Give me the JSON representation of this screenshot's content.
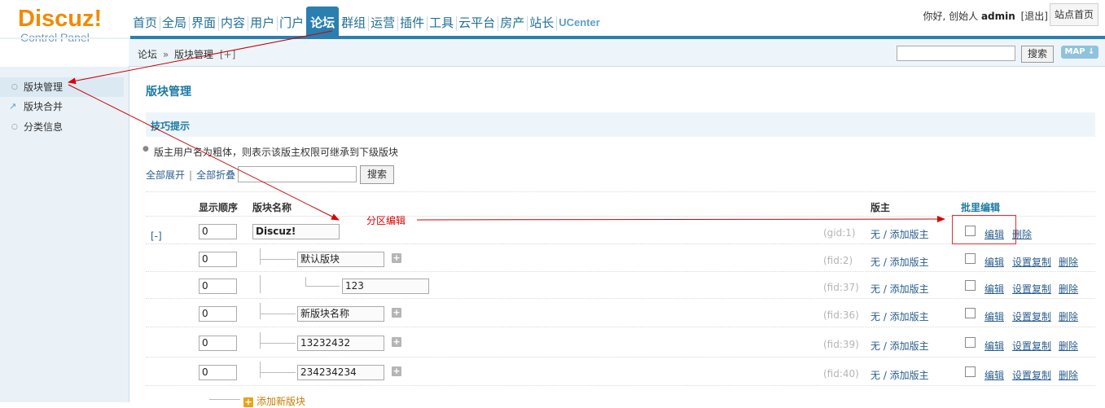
{
  "logo": {
    "main": "Discuz!",
    "sub": "Control Panel"
  },
  "nav": {
    "items": [
      "首页",
      "全局",
      "界面",
      "内容",
      "用户",
      "门户",
      "论坛",
      "群组",
      "运营",
      "插件",
      "工具",
      "云平台",
      "房产",
      "站长",
      "UCenter"
    ],
    "active_index": 6
  },
  "user": {
    "greeting": "你好, 创始人",
    "name": "admin",
    "logout": "[退出]",
    "site_home": "站点首页"
  },
  "breadcrumb": {
    "parent": "论坛",
    "separator": "»",
    "current": "版块管理",
    "plus": "[+]"
  },
  "top_search": {
    "button": "搜索",
    "map": "MAP ↓"
  },
  "sidebar": {
    "items": [
      {
        "label": "版块管理",
        "icon": "circle-icon",
        "active": true
      },
      {
        "label": "版块合并",
        "icon": "external-link-icon",
        "active": false
      },
      {
        "label": "分类信息",
        "icon": "circle-icon",
        "active": false
      }
    ]
  },
  "page": {
    "title": "版块管理",
    "tips_title": "技巧提示",
    "tip": "版主用户名为粗体，则表示该版主权限可继承到下级版块",
    "expand_all": "全部展开",
    "collapse_all": "全部折叠",
    "search_button": "搜索"
  },
  "table": {
    "headers": {
      "order": "显示顺序",
      "name": "版块名称",
      "moderators": "版主",
      "batch_edit": "批里编辑"
    },
    "rows": [
      {
        "toggle": "[-]",
        "order": "0",
        "name": "Discuz!",
        "id": "(gid:1)",
        "mods": "无 / 添加版主",
        "edit": "编辑",
        "copy": "",
        "del": "删除"
      },
      {
        "order": "0",
        "name": "默认版块",
        "id": "(fid:2)",
        "mods": "无 / 添加版主",
        "edit": "编辑",
        "copy": "设置复制",
        "del": "删除"
      },
      {
        "order": "0",
        "name": "123",
        "id": "(fid:37)",
        "mods": "无 / 添加版主",
        "edit": "编辑",
        "copy": "设置复制",
        "del": "删除"
      },
      {
        "order": "0",
        "name": "新版块名称",
        "id": "(fid:36)",
        "mods": "无 / 添加版主",
        "edit": "编辑",
        "copy": "设置复制",
        "del": "删除"
      },
      {
        "order": "0",
        "name": "13232432",
        "id": "(fid:39)",
        "mods": "无 / 添加版主",
        "edit": "编辑",
        "copy": "设置复制",
        "del": "删除"
      },
      {
        "order": "0",
        "name": "234234234",
        "id": "(fid:40)",
        "mods": "无 / 添加版主",
        "edit": "编辑",
        "copy": "设置复制",
        "del": "删除"
      }
    ],
    "add_new": "添加新版块"
  },
  "annotation": {
    "label": "分区编辑",
    "color": "#dd0000"
  },
  "colors": {
    "accent": "#2a7fb0",
    "title_blue": "#1c7aa4",
    "logo_orange": "#f28a00"
  }
}
